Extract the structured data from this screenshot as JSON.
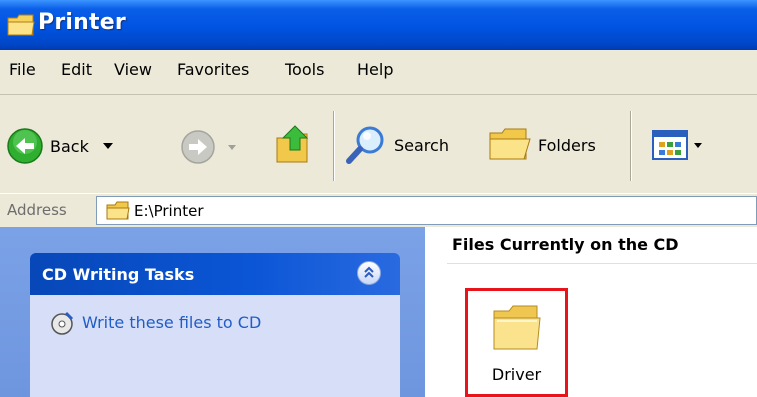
{
  "window": {
    "title": "Printer"
  },
  "menu": {
    "items": [
      "File",
      "Edit",
      "View",
      "Favorites",
      "Tools",
      "Help"
    ]
  },
  "toolbar": {
    "back_label": "Back",
    "search_label": "Search",
    "folders_label": "Folders"
  },
  "address": {
    "label": "Address",
    "value": "E:\\Printer"
  },
  "tasks": {
    "title": "CD Writing Tasks",
    "link": "Write these files to CD"
  },
  "content": {
    "header": "Files Currently on the CD",
    "items": [
      {
        "name": "Driver",
        "icon": "folder-icon"
      }
    ]
  },
  "colors": {
    "titlebar": "#0053e1",
    "task_header": "#0747b8",
    "task_body": "#d6dff7",
    "highlight": "#e8141b"
  }
}
